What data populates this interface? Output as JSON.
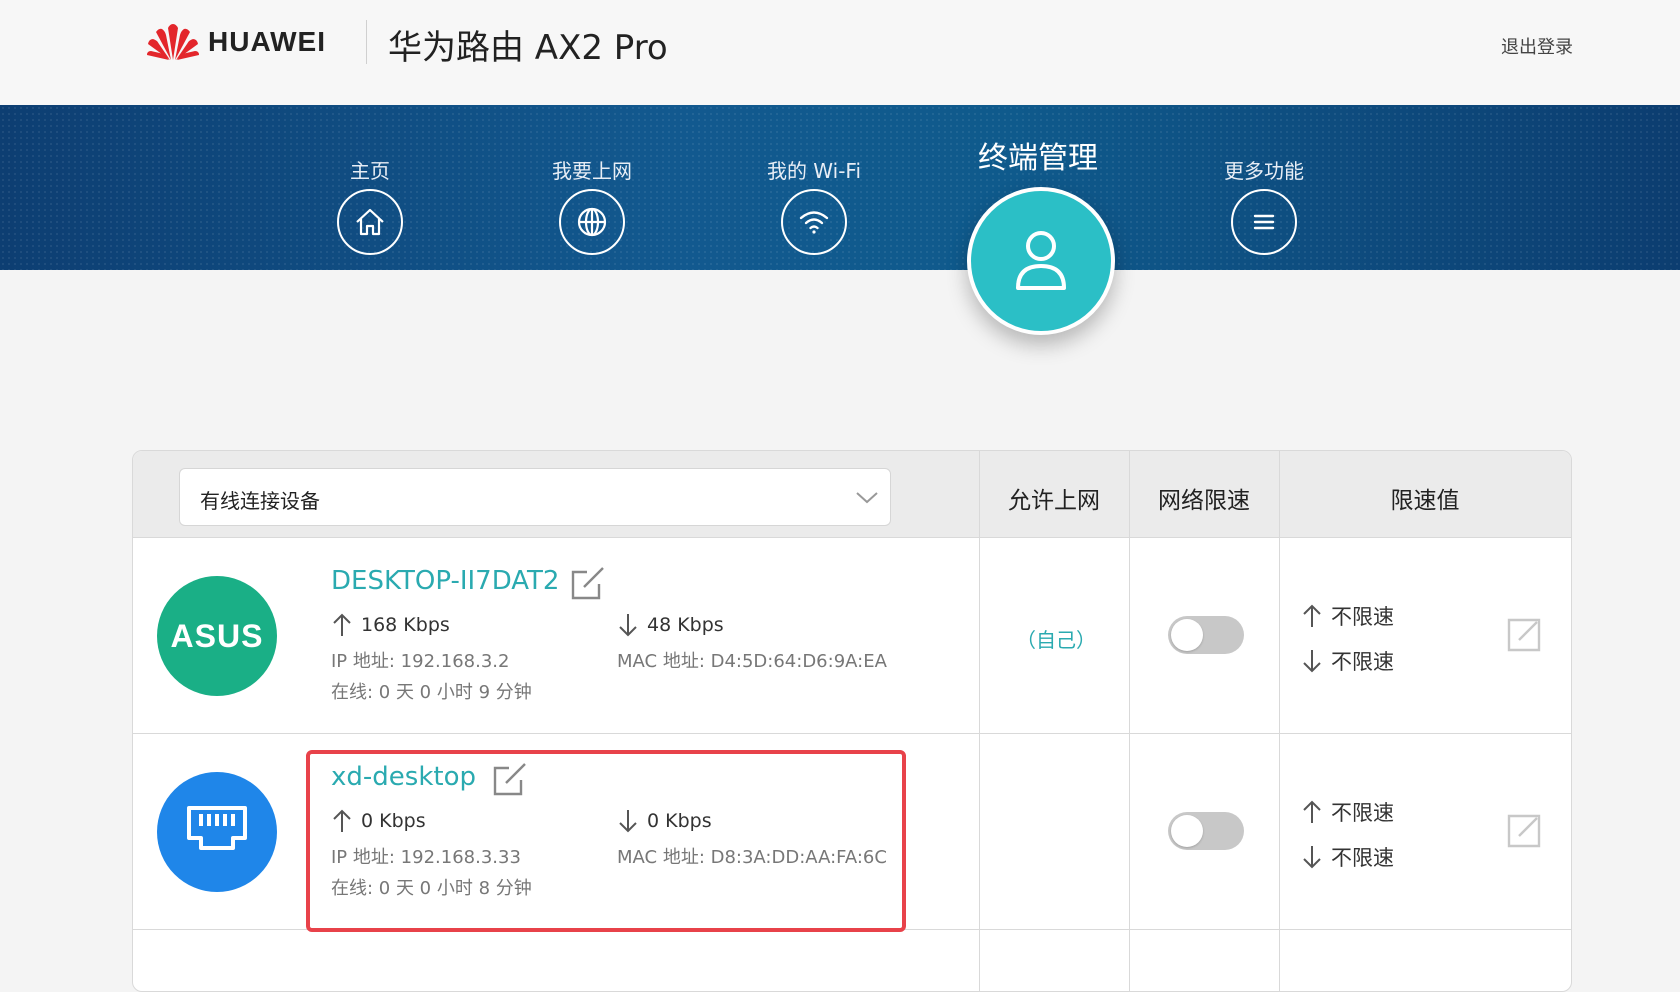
{
  "header": {
    "brand": "HUAWEI",
    "product_title": "华为路由 AX2 Pro",
    "logout": "退出登录"
  },
  "nav": {
    "items": [
      {
        "label": "主页",
        "icon": "home-icon"
      },
      {
        "label": "我要上网",
        "icon": "globe-icon"
      },
      {
        "label": "我的 Wi-Fi",
        "icon": "wifi-icon"
      },
      {
        "label": "终端管理",
        "icon": "user-icon",
        "active": true
      },
      {
        "label": "更多功能",
        "icon": "menu-icon"
      }
    ]
  },
  "table": {
    "filter": {
      "selected": "有线连接设备"
    },
    "columns": [
      "允许上网",
      "网络限速",
      "限速值"
    ],
    "rows": [
      {
        "avatar": "ASUS",
        "name": "DESKTOP-II7DAT2",
        "upload": "168 Kbps",
        "download": "48 Kbps",
        "ip": "IP 地址: 192.168.3.2",
        "mac": "MAC 地址: D4:5D:64:D6:9A:EA",
        "online": "在线: 0 天 0 小时 9 分钟",
        "allow": "（自己）",
        "speed_limit_on": false,
        "up_limit": "不限速",
        "down_limit": "不限速"
      },
      {
        "avatar": "ethernet-icon",
        "name": "xd-desktop",
        "upload": "0 Kbps",
        "download": "0 Kbps",
        "ip": "IP 地址: 192.168.3.33",
        "mac": "MAC 地址: D8:3A:DD:AA:FA:6C",
        "online": "在线: 0 天 0 小时 8 分钟",
        "allow": "",
        "speed_limit_on": false,
        "up_limit": "不限速",
        "down_limit": "不限速"
      }
    ]
  },
  "colors": {
    "accent_teal": "#2bbfc6",
    "link_teal": "#2aaab0",
    "asus_green": "#1aaf86",
    "ethernet_blue": "#1f86e9",
    "highlight_red": "#e8424a",
    "nav_blue": "#12598f"
  }
}
